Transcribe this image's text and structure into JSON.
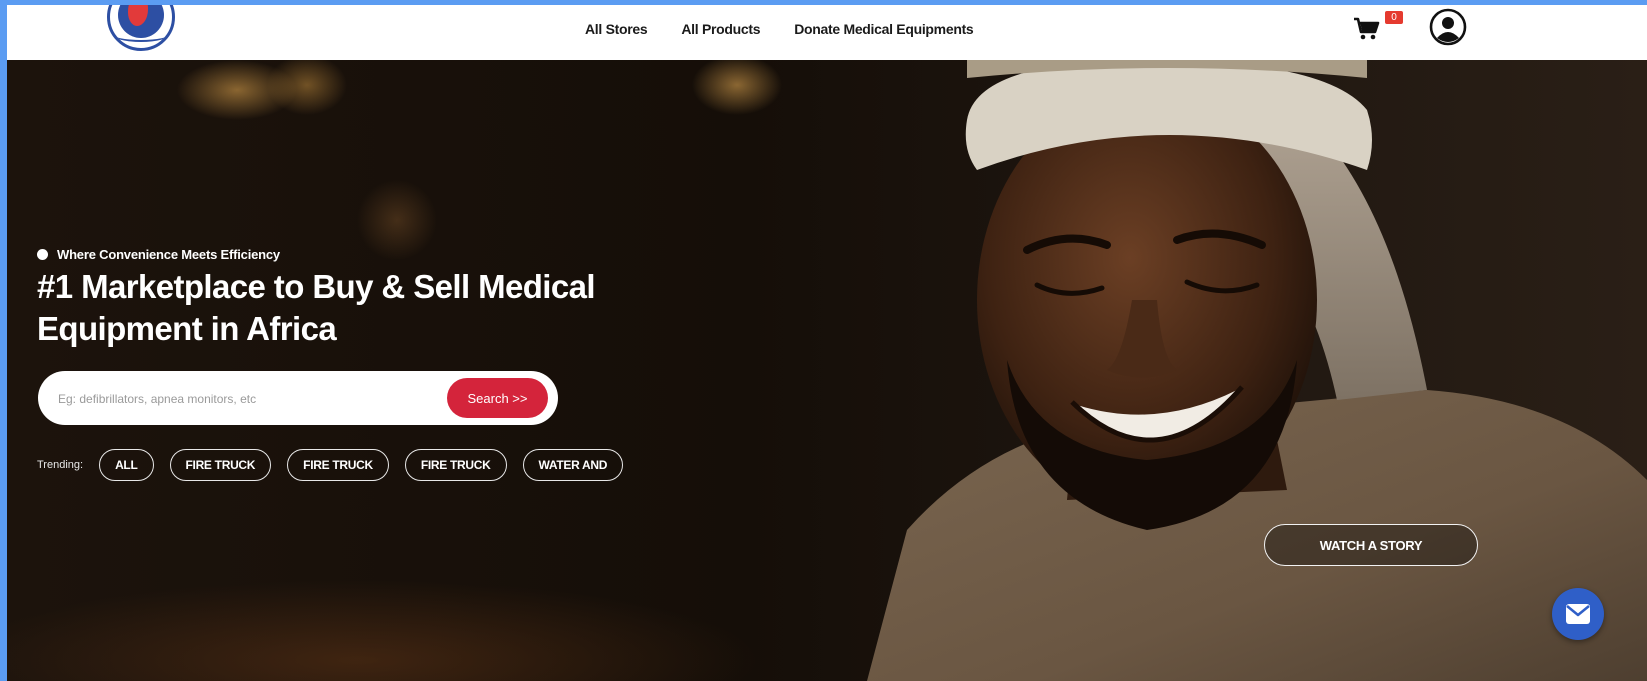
{
  "header": {
    "nav": [
      {
        "label": "All Stores"
      },
      {
        "label": "All Products"
      },
      {
        "label": "Donate Medical Equipments"
      }
    ],
    "cart_count": "0",
    "icons": {
      "cart": "cart-icon",
      "account": "user-circle-icon",
      "chat": "mail-icon"
    }
  },
  "hero": {
    "tagline": "Where Convenience Meets Efficiency",
    "headline_line1": "#1 Marketplace to Buy & Sell Medical",
    "headline_line2": "Equipment in Africa",
    "search": {
      "placeholder": "Eg: defibrillators, apnea monitors, etc",
      "value": "",
      "button_label": "Search >>"
    },
    "trending_label": "Trending:",
    "trending": [
      "ALL",
      "FIRE TRUCK",
      "FIRE TRUCK",
      "FIRE TRUCK",
      "WATER AND"
    ],
    "watch_story_label": "WATCH A STORY"
  },
  "colors": {
    "accent_red": "#d4243b",
    "chat_blue": "#2f5fc8",
    "badge_red": "#e53a2f",
    "page_border": "#5b9cf2"
  }
}
